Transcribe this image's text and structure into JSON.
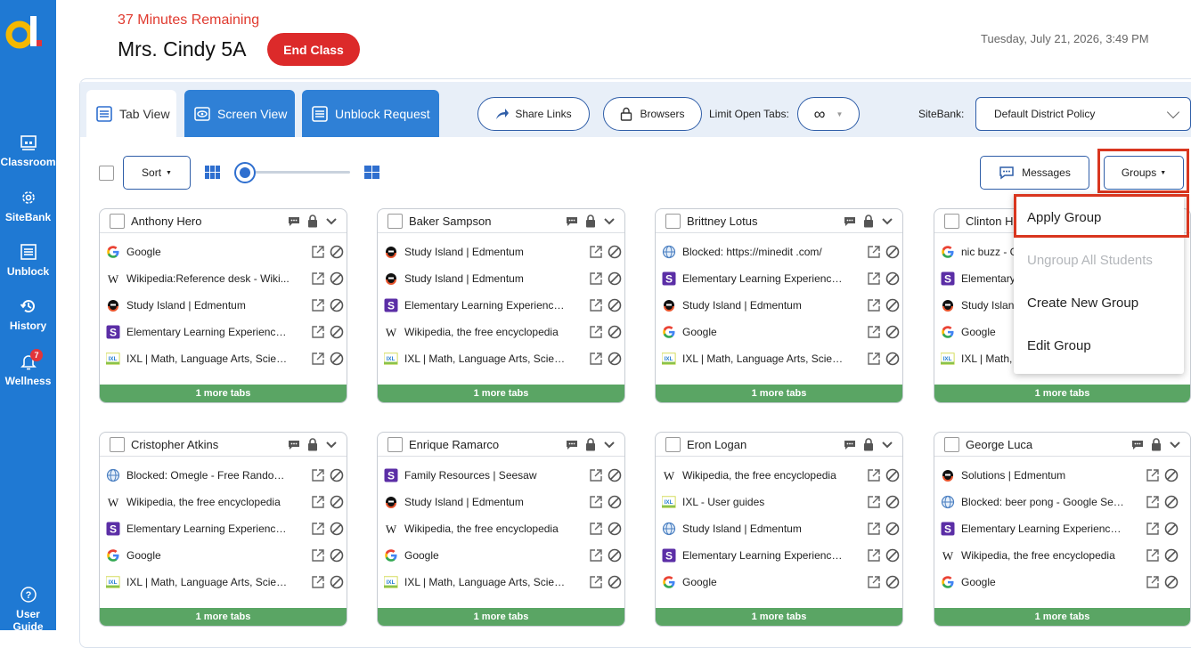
{
  "sidebar": {
    "items": [
      {
        "label": "Classroom",
        "icon": "classroom-icon"
      },
      {
        "label": "SiteBank",
        "icon": "gear-icon"
      },
      {
        "label": "Unblock",
        "icon": "list-icon"
      },
      {
        "label": "History",
        "icon": "history-icon"
      },
      {
        "label": "Wellness",
        "icon": "bell-icon",
        "badge": "7"
      }
    ],
    "guide": {
      "label": "User Guide",
      "icon": "help-icon"
    }
  },
  "header": {
    "remaining": "37 Minutes Remaining",
    "class_name": "Mrs. Cindy 5A",
    "end_class": "End Class",
    "datetime": "Tuesday, July 21, 2026, 3:49 PM"
  },
  "toolbar": {
    "tabs": [
      "Tab View",
      "Screen View",
      "Unblock Request"
    ],
    "share_links": "Share Links",
    "browsers": "Browsers",
    "limit_label": "Limit Open Tabs:",
    "limit_value": "∞",
    "sitebank_label": "SiteBank:",
    "sitebank_value": "Default District Policy",
    "sort": "Sort",
    "messages": "Messages",
    "groups": "Groups"
  },
  "groups_menu": [
    "Apply Group",
    "Ungroup All Students",
    "Create New Group",
    "Edit Group"
  ],
  "students": [
    {
      "name": "Anthony Hero",
      "more": "1 more tabs",
      "tabs": [
        {
          "icon": "google",
          "title": "Google"
        },
        {
          "icon": "wiki",
          "title": "Wikipedia:Reference desk - Wiki..."
        },
        {
          "icon": "edmentum",
          "title": "Study Island | Edmentum"
        },
        {
          "icon": "seesaw",
          "title": "Elementary Learning Experience ..."
        },
        {
          "icon": "ixl",
          "title": "IXL | Math, Language Arts, Scien..."
        }
      ]
    },
    {
      "name": "Baker Sampson",
      "more": "1 more tabs",
      "tabs": [
        {
          "icon": "edmentum",
          "title": "Study Island | Edmentum"
        },
        {
          "icon": "edmentum",
          "title": "Study Island | Edmentum"
        },
        {
          "icon": "seesaw",
          "title": "Elementary Learning Experience ..."
        },
        {
          "icon": "wiki",
          "title": "Wikipedia, the free encyclopedia"
        },
        {
          "icon": "ixl",
          "title": "IXL | Math, Language Arts, Scien..."
        }
      ]
    },
    {
      "name": "Brittney Lotus",
      "more": "1 more tabs",
      "tabs": [
        {
          "icon": "globe",
          "title": "Blocked: https://minedit .com/"
        },
        {
          "icon": "seesaw",
          "title": "Elementary Learning Experience ..."
        },
        {
          "icon": "edmentum",
          "title": "Study Island | Edmentum"
        },
        {
          "icon": "google",
          "title": "Google"
        },
        {
          "icon": "ixl",
          "title": "IXL | Math, Language Arts, Scien..."
        }
      ]
    },
    {
      "name": "Clinton H",
      "more": "1 more tabs",
      "tabs": [
        {
          "icon": "google",
          "title": "nic buzz - G"
        },
        {
          "icon": "seesaw",
          "title": "Elementary"
        },
        {
          "icon": "edmentum",
          "title": "Study Islan"
        },
        {
          "icon": "google",
          "title": "Google"
        },
        {
          "icon": "ixl",
          "title": "IXL | Math,"
        }
      ]
    },
    {
      "name": "Cristopher Atkins",
      "more": "1 more tabs",
      "tabs": [
        {
          "icon": "globe",
          "title": "Blocked: Omegle - Free Random ..."
        },
        {
          "icon": "wiki",
          "title": "Wikipedia, the free encyclopedia"
        },
        {
          "icon": "seesaw",
          "title": "Elementary Learning Experience ..."
        },
        {
          "icon": "google",
          "title": "Google"
        },
        {
          "icon": "ixl",
          "title": "IXL | Math, Language Arts, Scien..."
        }
      ]
    },
    {
      "name": "Enrique Ramarco",
      "more": "1 more tabs",
      "tabs": [
        {
          "icon": "seesaw",
          "title": "Family Resources | Seesaw"
        },
        {
          "icon": "edmentum",
          "title": "Study Island | Edmentum"
        },
        {
          "icon": "wiki",
          "title": "Wikipedia, the free encyclopedia"
        },
        {
          "icon": "google",
          "title": "Google"
        },
        {
          "icon": "ixl",
          "title": "IXL | Math, Language Arts, Scien..."
        }
      ]
    },
    {
      "name": "Eron Logan",
      "more": "1 more tabs",
      "tabs": [
        {
          "icon": "wiki",
          "title": "Wikipedia, the free encyclopedia"
        },
        {
          "icon": "ixl",
          "title": "IXL - User guides"
        },
        {
          "icon": "globe",
          "title": "Study Island | Edmentum"
        },
        {
          "icon": "seesaw",
          "title": "Elementary Learning Experience ..."
        },
        {
          "icon": "google",
          "title": "Google"
        }
      ]
    },
    {
      "name": "George Luca",
      "more": "1 more tabs",
      "tabs": [
        {
          "icon": "edmentum",
          "title": "Solutions | Edmentum"
        },
        {
          "icon": "globe",
          "title": "Blocked: beer pong - Google Sea..."
        },
        {
          "icon": "seesaw",
          "title": "Elementary Learning Experience ..."
        },
        {
          "icon": "wiki",
          "title": "Wikipedia, the free encyclopedia"
        },
        {
          "icon": "google",
          "title": "Google"
        }
      ]
    }
  ]
}
